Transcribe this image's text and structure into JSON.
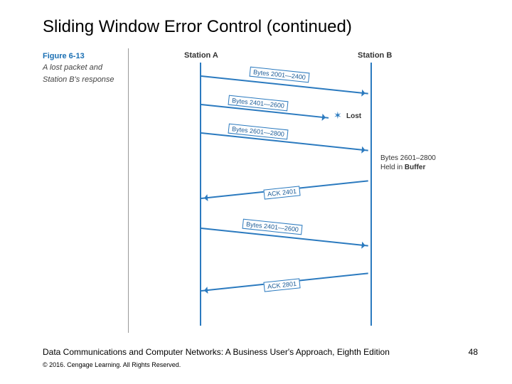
{
  "title": "Sliding Window Error Control (continued)",
  "figure": {
    "number": "Figure 6-13",
    "caption_l1": "A lost packet and",
    "caption_l2": "Station B's response"
  },
  "stations": {
    "a": "Station A",
    "b": "Station B"
  },
  "messages": {
    "m1": "Bytes 2001—2400",
    "m2": "Bytes 2401—2600",
    "m3": "Bytes 2601—2800",
    "lost": "Lost",
    "buffer_l1": "Bytes 2601–2800",
    "buffer_l2_prefix": "Held in ",
    "buffer_l2_bold": "Buffer",
    "ack1": "ACK 2401",
    "m4": "Bytes 2401—2600",
    "ack2": "ACK 2801"
  },
  "footer": "Data Communications and Computer Networks: A Business User's Approach, Eighth Edition",
  "copyright": "© 2016. Cengage Learning. All Rights Reserved.",
  "page": "48"
}
